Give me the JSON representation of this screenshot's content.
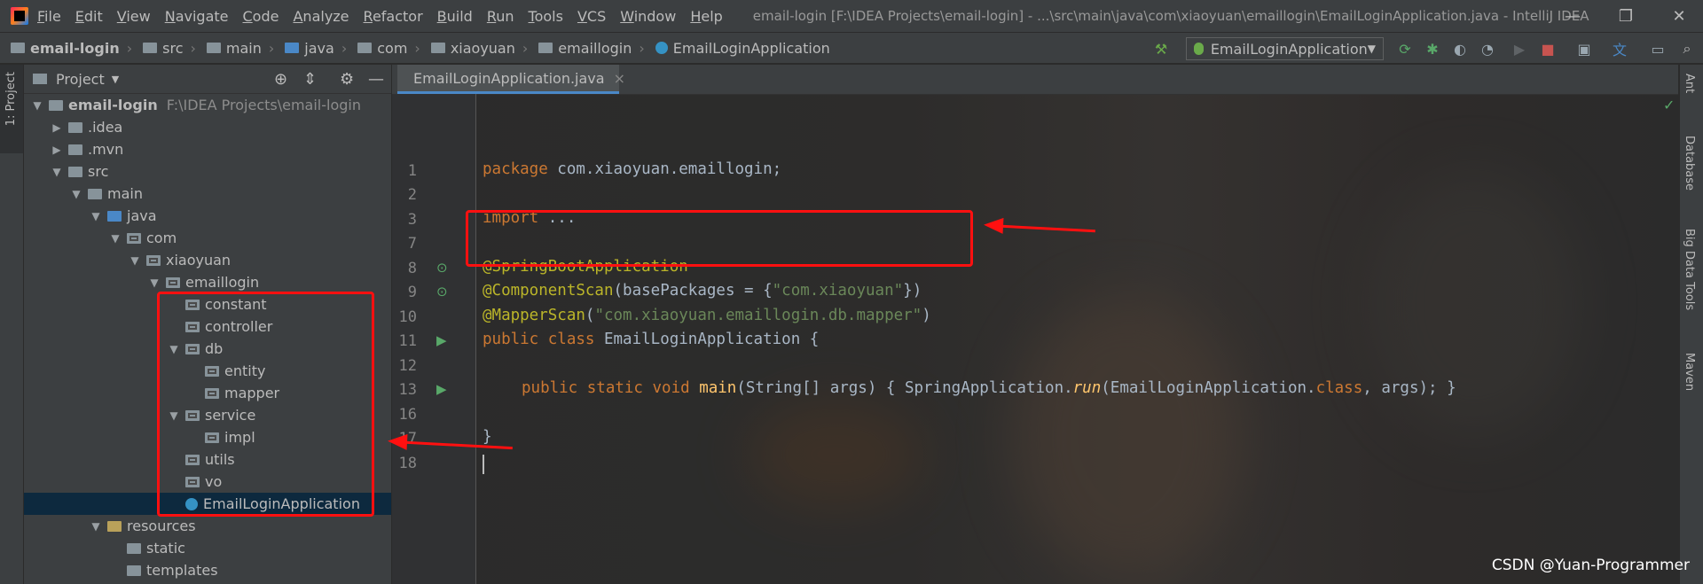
{
  "menu": [
    "File",
    "Edit",
    "View",
    "Navigate",
    "Code",
    "Analyze",
    "Refactor",
    "Build",
    "Run",
    "Tools",
    "VCS",
    "Window",
    "Help"
  ],
  "window_title": "email-login [F:\\IDEA Projects\\email-login] - ...\\src\\main\\java\\com\\xiaoyuan\\emaillogin\\EmailLoginApplication.java - IntelliJ IDEA",
  "window_controls": {
    "minimize": "—",
    "restore": "❐",
    "close": "✕"
  },
  "breadcrumbs": [
    "email-login",
    "src",
    "main",
    "java",
    "com",
    "xiaoyuan",
    "emaillogin",
    "EmailLoginApplication"
  ],
  "run_config": "EmailLoginApplication",
  "left_stripe_tab": "1: Project",
  "project_panel": {
    "title": "Project",
    "tree": [
      {
        "label": "email-login",
        "path": "F:\\IDEA Projects\\email-login",
        "arrow": "▼",
        "icon": "folder"
      },
      {
        "label": ".idea",
        "arrow": "▶",
        "icon": "folder"
      },
      {
        "label": ".mvn",
        "arrow": "▶",
        "icon": "folder"
      },
      {
        "label": "src",
        "arrow": "▼",
        "icon": "folder"
      },
      {
        "label": "main",
        "arrow": "▼",
        "icon": "folder"
      },
      {
        "label": "java",
        "arrow": "▼",
        "icon": "folder-blue"
      },
      {
        "label": "com",
        "arrow": "▼",
        "icon": "package"
      },
      {
        "label": "xiaoyuan",
        "arrow": "▼",
        "icon": "package"
      },
      {
        "label": "emaillogin",
        "arrow": "▼",
        "icon": "package"
      },
      {
        "label": "constant",
        "arrow": "",
        "icon": "package"
      },
      {
        "label": "controller",
        "arrow": "",
        "icon": "package"
      },
      {
        "label": "db",
        "arrow": "▼",
        "icon": "package"
      },
      {
        "label": "entity",
        "arrow": "",
        "icon": "package"
      },
      {
        "label": "mapper",
        "arrow": "",
        "icon": "package"
      },
      {
        "label": "service",
        "arrow": "▼",
        "icon": "package"
      },
      {
        "label": "impl",
        "arrow": "",
        "icon": "package"
      },
      {
        "label": "utils",
        "arrow": "",
        "icon": "package"
      },
      {
        "label": "vo",
        "arrow": "",
        "icon": "package"
      },
      {
        "label": "EmailLoginApplication",
        "arrow": "",
        "icon": "class",
        "selected": true
      },
      {
        "label": "resources",
        "arrow": "▼",
        "icon": "resources"
      },
      {
        "label": "static",
        "arrow": "",
        "icon": "folder"
      },
      {
        "label": "templates",
        "arrow": "",
        "icon": "folder"
      }
    ]
  },
  "editor": {
    "tab_label": "EmailLoginApplication.java",
    "tab_close": "×",
    "line_numbers": [
      "1",
      "2",
      "3",
      "7",
      "8",
      "9",
      "10",
      "11",
      "12",
      "13",
      "16",
      "17",
      "18"
    ],
    "lines": {
      "l1_kw": "package",
      "l1_rest": " com.xiaoyuan.emaillogin;",
      "l3_kw": "import",
      "l3_fold": " ...",
      "l8": "@SpringBootApplication",
      "l9_ann": "@ComponentScan",
      "l9_a": "(basePackages = {",
      "l9_str": "\"com.xiaoyuan\"",
      "l9_b": "})",
      "l10_ann": "@MapperScan",
      "l10_a": "(",
      "l10_str": "\"com.xiaoyuan.emaillogin.db.mapper\"",
      "l10_b": ")",
      "l11_kw": "public class",
      "l11_rest": " EmailLoginApplication {",
      "l13_kw": "public static void",
      "l13_fn": " main",
      "l13_a": "(String[] args) { SpringApplication.",
      "l13_run": "run",
      "l13_b": "(EmailLoginApplication.",
      "l13_cls": "class",
      "l13_c": ", args); }",
      "l17": "}"
    }
  },
  "right_stripe": [
    "Ant",
    "Database",
    "Big Data Tools",
    "Maven"
  ],
  "watermark": "CSDN @Yuan-Programmer"
}
